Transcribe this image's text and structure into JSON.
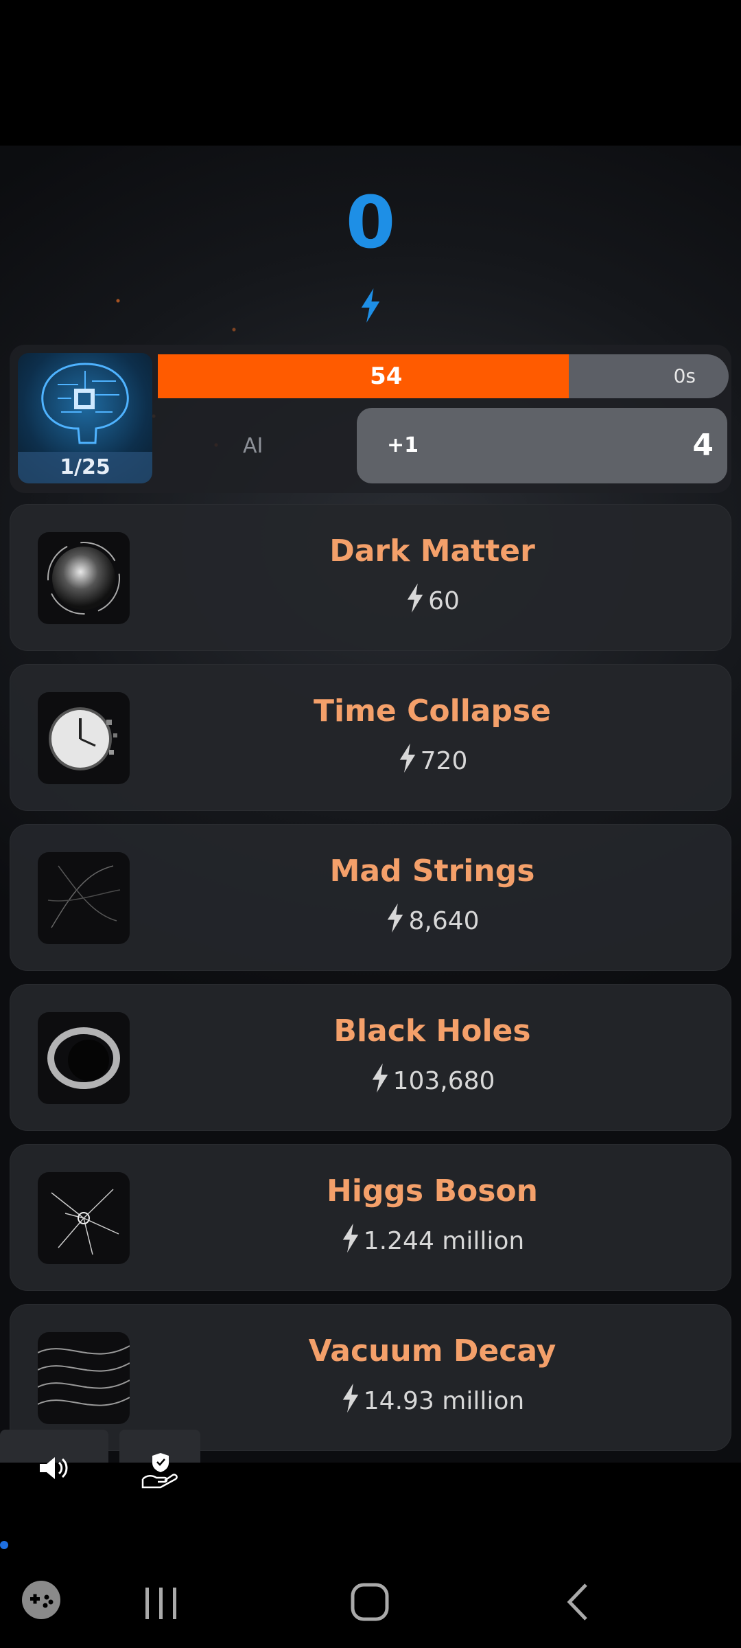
{
  "score": {
    "value": "0"
  },
  "ai_panel": {
    "level": "1/25",
    "ai_label": "AI",
    "progress": {
      "value": "54",
      "time": "0s",
      "fill_fraction": 0.72
    },
    "upgrade": {
      "plus": "+1",
      "count": "4"
    }
  },
  "generators": [
    {
      "name": "Dark Matter",
      "cost": "60",
      "icon": "dark-matter-sphere-icon"
    },
    {
      "name": "Time Collapse",
      "cost": "720",
      "icon": "shattered-clock-icon"
    },
    {
      "name": "Mad Strings",
      "cost": "8,640",
      "icon": "strings-icon"
    },
    {
      "name": "Black Holes",
      "cost": "103,680",
      "icon": "black-hole-icon"
    },
    {
      "name": "Higgs Boson",
      "cost": "1.244 million",
      "icon": "particle-collision-icon"
    },
    {
      "name": "Vacuum Decay",
      "cost": "14.93 million",
      "icon": "vacuum-waves-icon"
    }
  ],
  "colors": {
    "score": "#1e8fe6",
    "progress": "#ff5b00",
    "title": "#f4a06a"
  }
}
